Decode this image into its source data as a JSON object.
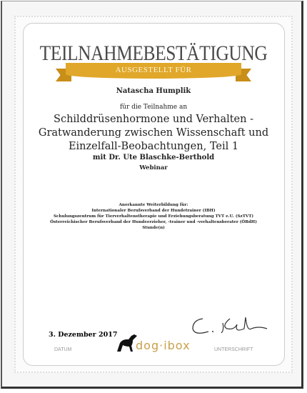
{
  "certificate": {
    "title": "TEILNAHMEBESTÄTIGUNG",
    "ribbon_text": "AUSGESTELLT FÜR",
    "recipient": "Natascha Humplik",
    "intro": "für die Teilnahme an",
    "course_lines": [
      "Schilddrüsenhormone und Verhalten -",
      "Gratwanderung zwischen Wissenschaft und",
      "Einzelfall-Beobachtungen, Teil 1"
    ],
    "instructor": "mit Dr. Ute Blaschke-Berthold",
    "format": "Webinar",
    "recognition": [
      "Anerkannte Weiterbildung für:",
      "Internationaler Berufsverband der Hundetrainer (IBH)",
      "Schulungszentrum für Tierverhaltenstherapie und Erziehungsberatung TVT e.U. (SzTVT)",
      "Österreichischer Berufsverband der Hundeerzieher, -trainer und -verhaltensberater (ÖBdH)",
      "Stunde(n)"
    ],
    "date": "3. Dezember 2017",
    "date_label": "DATUM",
    "signature_label": "UNTERSCHRIFT",
    "logo_text": "dog·ibox",
    "ribbon_color": "#e0a72a"
  }
}
